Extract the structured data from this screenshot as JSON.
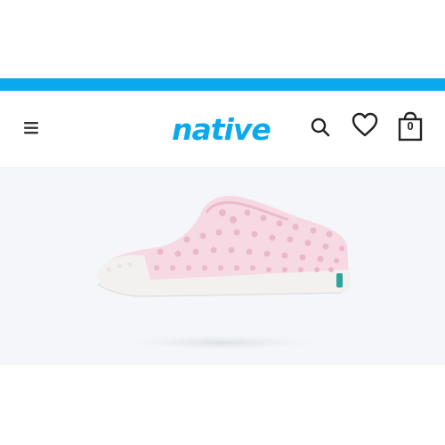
{
  "brand": {
    "logo_text": "native",
    "color": "#0aa9ee"
  },
  "header": {
    "menu_icon": "hamburger-menu-icon",
    "search_icon": "search-icon",
    "wishlist_icon": "heart-icon",
    "cart_icon": "shopping-bag-icon",
    "cart_count": "0"
  },
  "hero": {
    "image": "pink-perforated-slip-on-shoe",
    "shoe_color": "#f7d9e3",
    "sole_color": "#f3f1f0",
    "tab_color": "#2aa59a"
  }
}
